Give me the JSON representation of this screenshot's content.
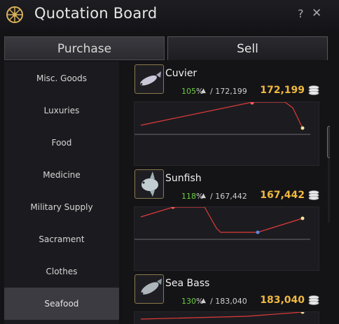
{
  "window": {
    "title": "Quotation Board",
    "help_label": "?",
    "close_label": "✕"
  },
  "tabs": [
    {
      "label": "Purchase",
      "active": false
    },
    {
      "label": "Sell",
      "active": true
    }
  ],
  "sidebar": {
    "items": [
      {
        "label": "Misc. Goods"
      },
      {
        "label": "Luxuries"
      },
      {
        "label": "Food"
      },
      {
        "label": "Medicine"
      },
      {
        "label": "Military Supply"
      },
      {
        "label": "Sacrament"
      },
      {
        "label": "Clothes"
      },
      {
        "label": "Seafood",
        "active": true
      }
    ]
  },
  "items": [
    {
      "name": "Cuvier",
      "percent": "105",
      "percent_unit": "%",
      "arrow": "▲",
      "base_price": "/ 172,199",
      "price": "172,199",
      "icon": "fish-icon"
    },
    {
      "name": "Sunfish",
      "percent": "118",
      "percent_unit": "%",
      "arrow": "▲",
      "base_price": "/ 167,442",
      "price": "167,442",
      "icon": "sunfish-icon"
    },
    {
      "name": "Sea Bass",
      "percent": "130",
      "percent_unit": "%",
      "arrow": "▲",
      "base_price": "/ 183,040",
      "price": "183,040",
      "icon": "fish-icon"
    }
  ],
  "colors": {
    "accent_gold": "#f0b840",
    "percent_green": "#6ccf3f",
    "graph_line": "#e03a3a"
  }
}
